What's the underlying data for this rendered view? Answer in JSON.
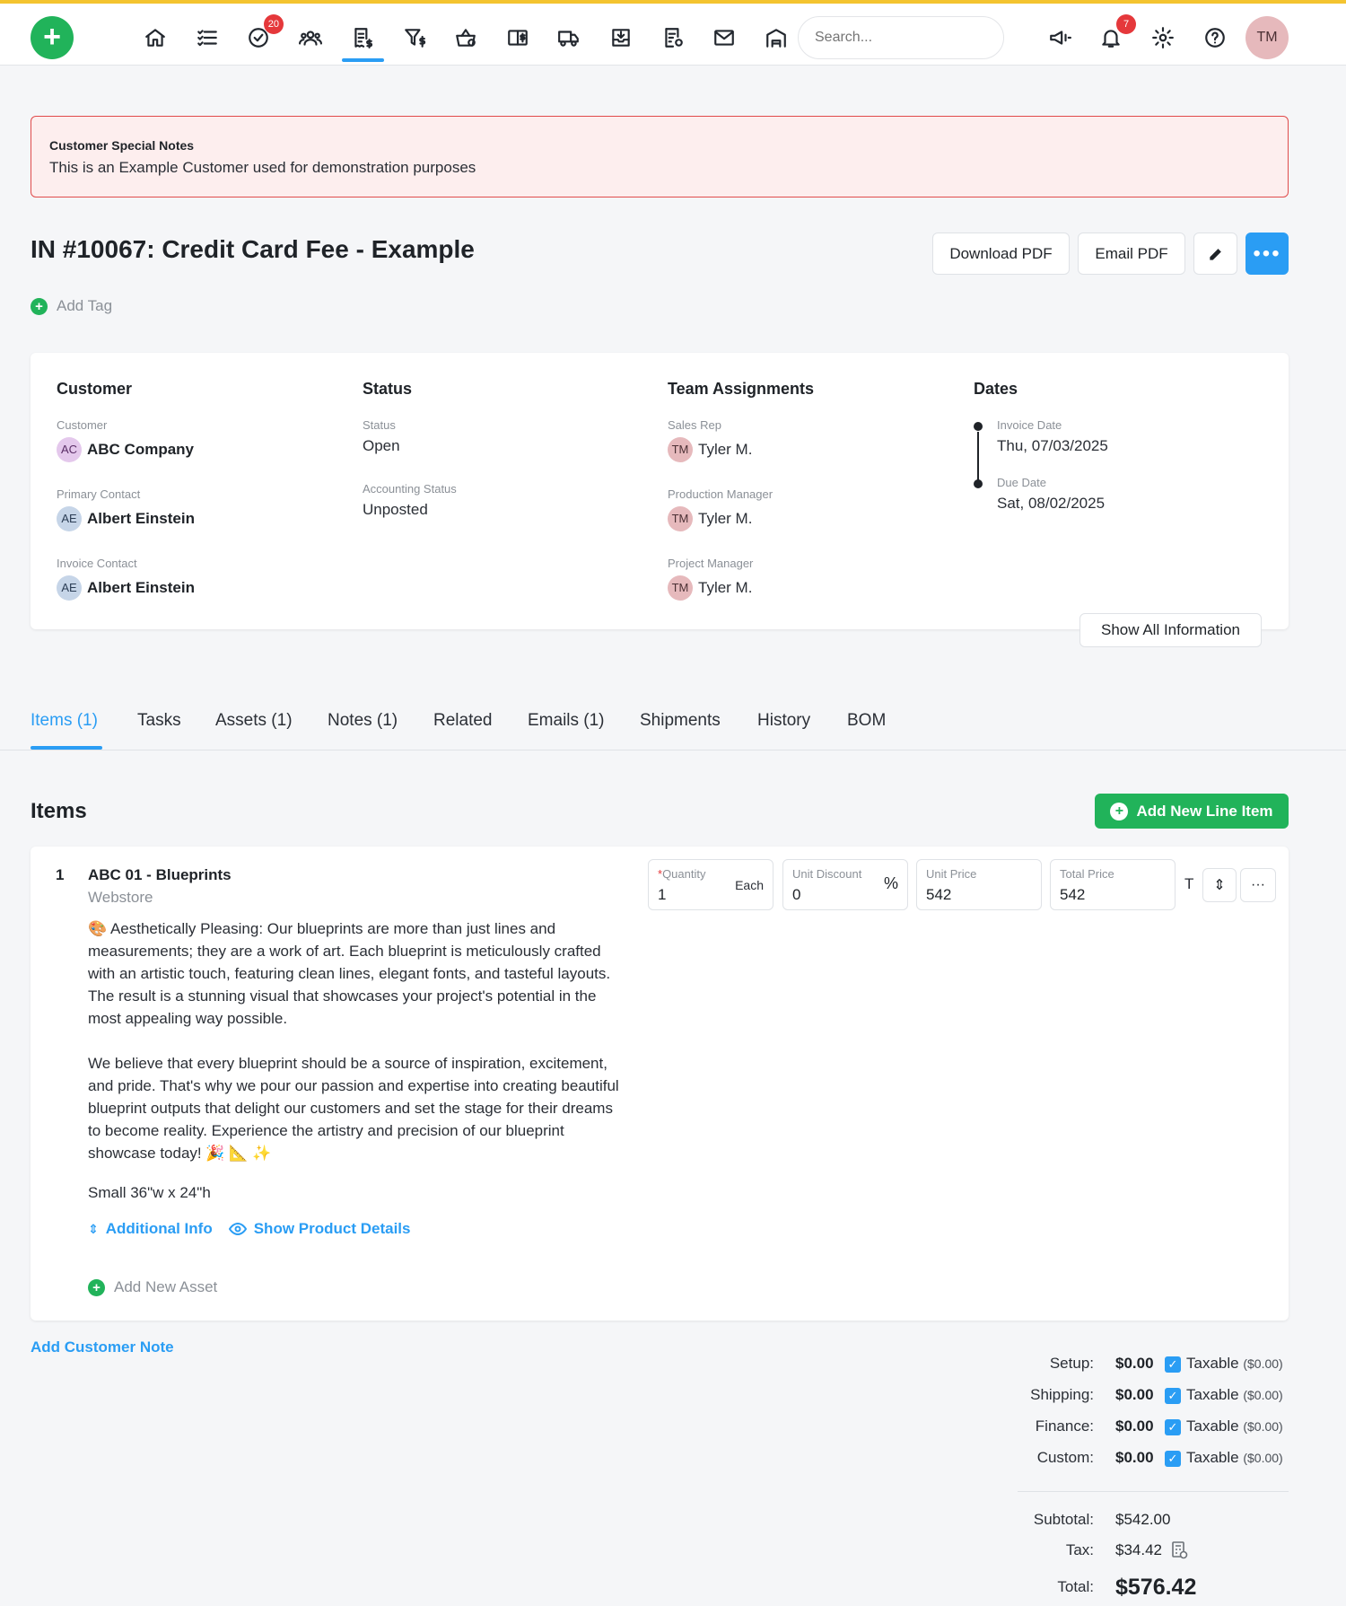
{
  "nav": {
    "task_badge": "20",
    "notif_badge": "7",
    "search_placeholder": "Search...",
    "avatar": "TM",
    "icons": [
      "home-icon",
      "list-icon",
      "check-circle-icon",
      "users-icon",
      "invoice-icon",
      "filter-dollar-icon",
      "basket-icon",
      "book-dollar-icon",
      "truck-icon",
      "inbox-icon",
      "report-gear-icon",
      "mail-icon",
      "warehouse-icon",
      "megaphone-icon",
      "bell-icon",
      "gear-icon",
      "help-icon"
    ]
  },
  "notes": {
    "title": "Customer Special Notes",
    "text": "This is an Example Customer used for demonstration purposes"
  },
  "header": {
    "title": "IN #10067: Credit Card Fee - Example",
    "download_pdf": "Download PDF",
    "email_pdf": "Email PDF",
    "more": "•••",
    "add_tag": "Add Tag"
  },
  "info": {
    "customer": {
      "heading": "Customer",
      "customer_label": "Customer",
      "customer_initials": "AC",
      "customer_value": "ABC Company",
      "primary_label": "Primary Contact",
      "primary_initials": "AE",
      "primary_value": "Albert Einstein",
      "invoice_label": "Invoice Contact",
      "invoice_initials": "AE",
      "invoice_value": "Albert Einstein"
    },
    "status": {
      "heading": "Status",
      "status_label": "Status",
      "status_value": "Open",
      "acct_label": "Accounting Status",
      "acct_value": "Unposted"
    },
    "team": {
      "heading": "Team Assignments",
      "sales_label": "Sales Rep",
      "sales_initials": "TM",
      "sales_value": "Tyler M.",
      "prod_label": "Production Manager",
      "prod_initials": "TM",
      "prod_value": "Tyler M.",
      "proj_label": "Project Manager",
      "proj_initials": "TM",
      "proj_value": "Tyler M."
    },
    "dates": {
      "heading": "Dates",
      "invoice_label": "Invoice Date",
      "invoice_value": "Thu, 07/03/2025",
      "due_label": "Due Date",
      "due_value": "Sat, 08/02/2025"
    },
    "show_all": "Show All Information"
  },
  "tabs": [
    "Items (1)",
    "Tasks",
    "Assets (1)",
    "Notes (1)",
    "Related",
    "Emails (1)",
    "Shipments",
    "History",
    "BOM"
  ],
  "items": {
    "heading": "Items",
    "add_line": "Add New Line Item",
    "line": {
      "num": "1",
      "name": "ABC 01 - Blueprints",
      "source": "Webstore",
      "desc1": "🎨 Aesthetically Pleasing: Our blueprints are more than just lines and measurements; they are a work of art. Each blueprint is meticulously crafted with an artistic touch, featuring clean lines, elegant fonts, and tasteful layouts. The result is a stunning visual that showcases your project's potential in the most appealing way possible.",
      "desc2": "We believe that every blueprint should be a source of inspiration, excitement, and pride. That's why we pour our passion and expertise into creating beautiful blueprint outputs that delight our customers and set the stage for their dreams to become reality. Experience the artistry and precision of our blueprint showcase today! 🎉 📐 ✨",
      "size": "Small 36\"w x 24\"h",
      "additional_info": "Additional Info",
      "show_details": "Show Product Details",
      "add_asset": "Add New Asset",
      "qty_label": "Quantity",
      "qty_value": "1",
      "qty_unit": "Each",
      "disc_label": "Unit Discount",
      "disc_value": "0",
      "disc_unit": "%",
      "price_label": "Unit Price",
      "price_value": "542",
      "total_label": "Total Price",
      "total_value": "542",
      "tax_flag": "T",
      "menu": "···"
    },
    "add_customer_note": "Add Customer Note"
  },
  "totals": {
    "setup_label": "Setup:",
    "setup_value": "$0.00",
    "shipping_label": "Shipping:",
    "shipping_value": "$0.00",
    "finance_label": "Finance:",
    "finance_value": "$0.00",
    "custom_label": "Custom:",
    "custom_value": "$0.00",
    "taxable": "Taxable",
    "taxable_amount": "($0.00)",
    "subtotal_label": "Subtotal:",
    "subtotal_value": "$542.00",
    "tax_label": "Tax:",
    "tax_value": "$34.42",
    "total_label": "Total:",
    "total_value": "$576.42"
  },
  "colors": {
    "accent": "#2a9df4",
    "green": "#21b35a",
    "badge": "#e5383b",
    "top_stripe": "#f4c430",
    "notes_bg": "#fdeeee",
    "notes_border": "#e04b4b"
  }
}
